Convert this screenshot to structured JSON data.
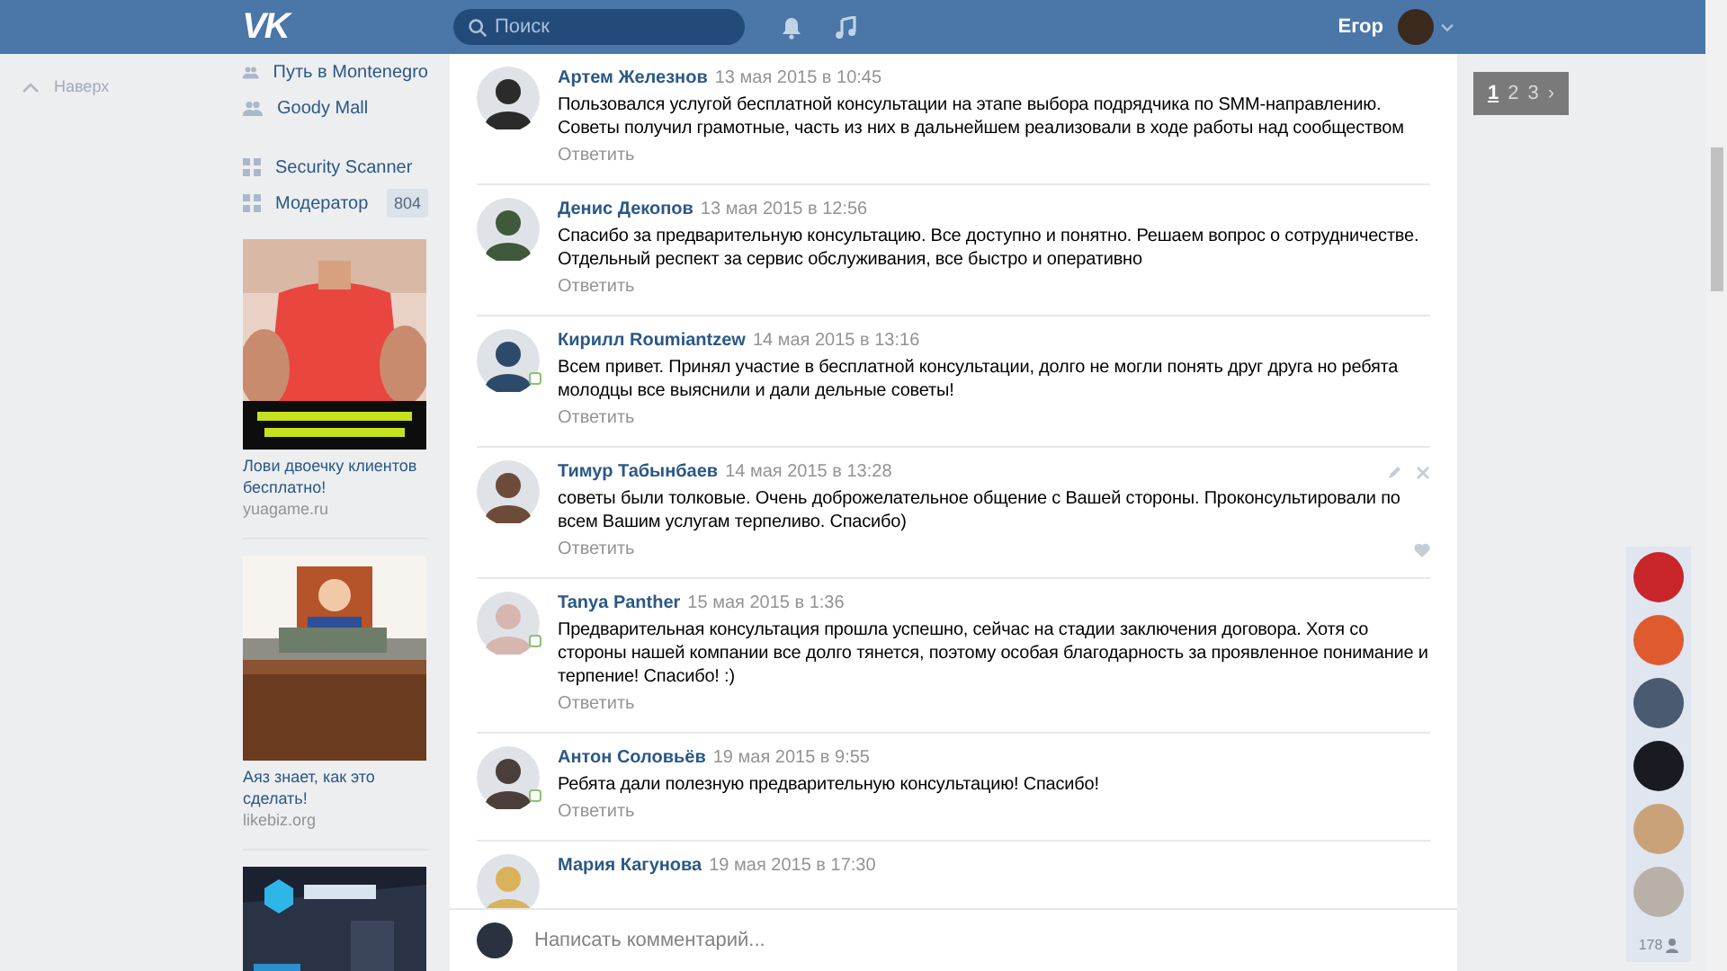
{
  "header": {
    "logo": "VK",
    "search": {
      "placeholder": "Поиск"
    },
    "user_name": "Егор"
  },
  "back_to_top": "Наверх",
  "sidebar": {
    "groups": [
      {
        "label": "Путь в Montenegro",
        "kind": "group"
      },
      {
        "label": "Goody Mall",
        "kind": "group"
      },
      {
        "label": "Security Scanner",
        "kind": "app"
      },
      {
        "label": "Модератор",
        "kind": "app",
        "badge": "804"
      }
    ]
  },
  "ads": [
    {
      "title": "Лови двоечку клиентов бесплатно!",
      "domain": "yuagame.ru",
      "kind": "picture"
    },
    {
      "title": "Аяз знает, как это сделать!",
      "domain": "likebiz.org",
      "kind": "picture"
    },
    {
      "kind": "picture"
    }
  ],
  "pager": {
    "pages": [
      {
        "label": "1",
        "selected": true
      },
      {
        "label": "2",
        "selected": false
      },
      {
        "label": "3",
        "selected": false
      }
    ],
    "next": "›"
  },
  "comments": [
    {
      "author": "Артем Железнов",
      "date": "13 мая 2015 в 10:45",
      "text": "Пользовался услугой бесплатной консультации на этапе выбора подрядчика по SMM-направлению. Советы получил грамотные, часть из них в дальнейшем реализовали в ходе работы над сообществом",
      "reply": "Ответить",
      "online": false,
      "own": false
    },
    {
      "author": "Денис Декопов",
      "date": "13 мая 2015 в 12:56",
      "text": "Спасибо за предварительную консультацию. Все доступно и понятно. Решаем вопрос о сотрудничестве. Отдельный респект за сервис обслуживания, все быстро и оперативно",
      "reply": "Ответить",
      "online": false,
      "own": false
    },
    {
      "author": "Кирилл Roumiantzew",
      "date": "14 мая 2015 в 13:16",
      "text": "Всем привет. Принял участие в бесплатной консультации, долго не могли понять друг друга но ребята молодцы все выяснили и дали дельные советы!",
      "reply": "Ответить",
      "online": true,
      "own": false
    },
    {
      "author": "Тимур Табынбаев",
      "date": "14 мая 2015 в 13:28",
      "text": "советы были толковые. Очень доброжелательное общение с Вашей стороны. Проконсультировали по всем Вашим услугам терпеливо. Спасибо)",
      "reply": "Ответить",
      "online": false,
      "own": true
    },
    {
      "author": "Tanya Panther",
      "date": "15 мая 2015 в 1:36",
      "text": "Предварительная консультация прошла успешно, сейчас на стадии заключения договора. Хотя со стороны нашей компании все долго тянется, поэтому особая благодарность за проявленное понимание и терпение! Спасибо! :)",
      "reply": "Ответить",
      "online": true,
      "own": false
    },
    {
      "author": "Антон Соловьёв",
      "date": "19 мая 2015 в 9:55",
      "text": "Ребята дали полезную предварительную консультацию! Спасибо!",
      "reply": "Ответить",
      "online": true,
      "own": false
    },
    {
      "author": "Мария Кагунова",
      "date": "19 мая 2015 в 17:30",
      "online": false,
      "own": false
    }
  ],
  "composer": {
    "placeholder": "Написать комментарий..."
  },
  "friends": {
    "count": "178"
  }
}
